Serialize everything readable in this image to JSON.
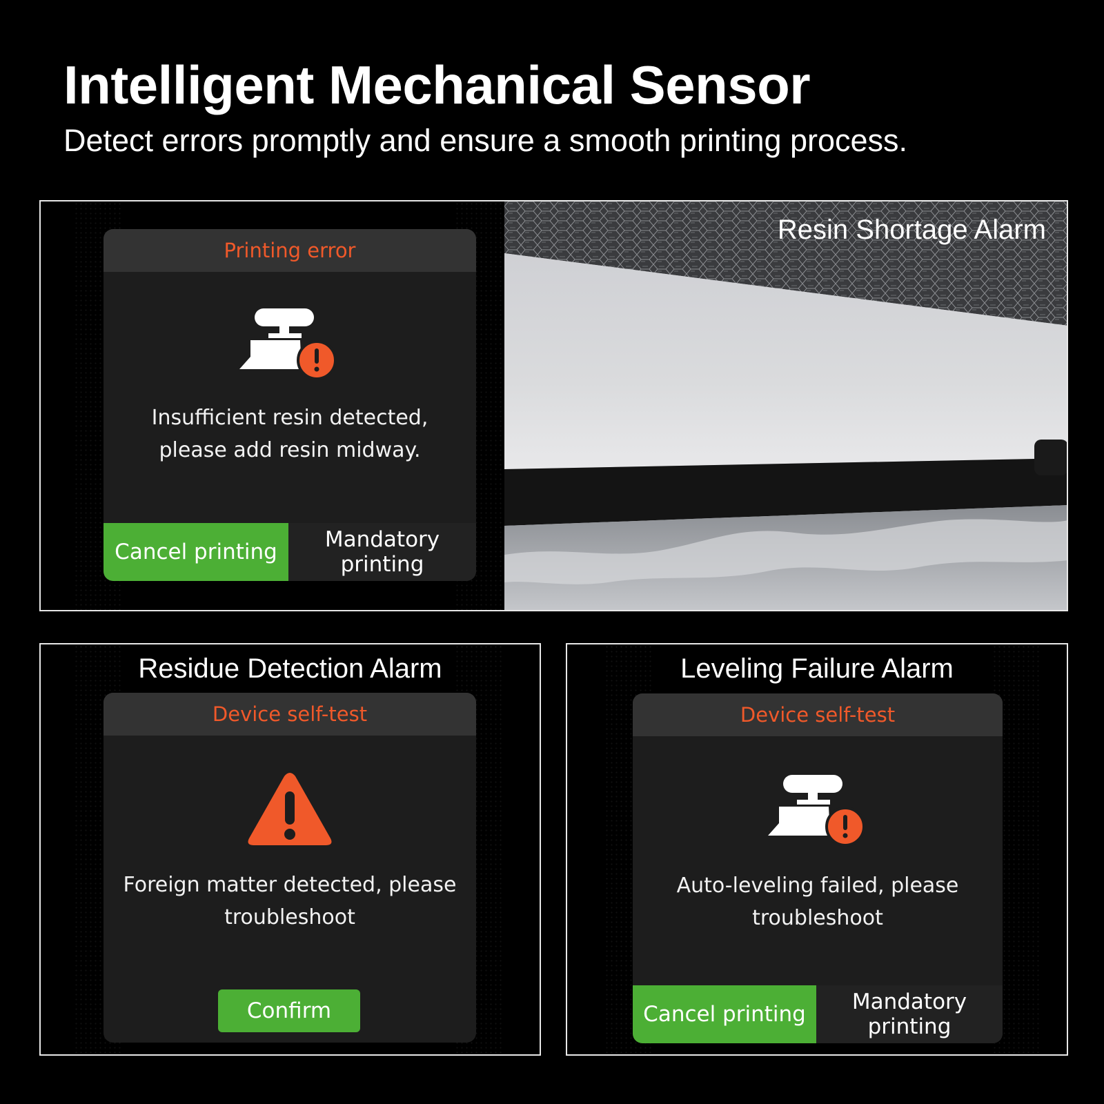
{
  "heading": {
    "title": "Intelligent Mechanical Sensor",
    "subtitle": "Detect errors promptly and ensure a smooth printing process."
  },
  "panels": {
    "resin": {
      "label": "Resin Shortage Alarm",
      "screen": {
        "header": "Printing error",
        "icon": "printer-warning-icon",
        "message_lines": [
          "Insufficient resin detected,",
          "please add resin midway."
        ],
        "cancel": "Cancel printing",
        "mandatory_lines": [
          "Mandatory",
          "printing"
        ]
      }
    },
    "residue": {
      "label": "Residue Detection Alarm",
      "screen": {
        "header": "Device self-test",
        "icon": "warning-triangle-icon",
        "message_lines": [
          "Foreign matter detected, please",
          "troubleshoot"
        ],
        "confirm": "Confirm"
      }
    },
    "leveling": {
      "label": "Leveling Failure Alarm",
      "screen": {
        "header": "Device self-test",
        "icon": "printer-warning-icon",
        "message_lines": [
          "Auto-leveling failed, please",
          "troubleshoot"
        ],
        "cancel": "Cancel printing",
        "mandatory_lines": [
          "Mandatory",
          "printing"
        ]
      }
    }
  },
  "colors": {
    "alert_orange": "#f0592a",
    "button_green": "#4caf35",
    "screen_bg": "#1d1d1d",
    "header_bg": "#333333"
  }
}
